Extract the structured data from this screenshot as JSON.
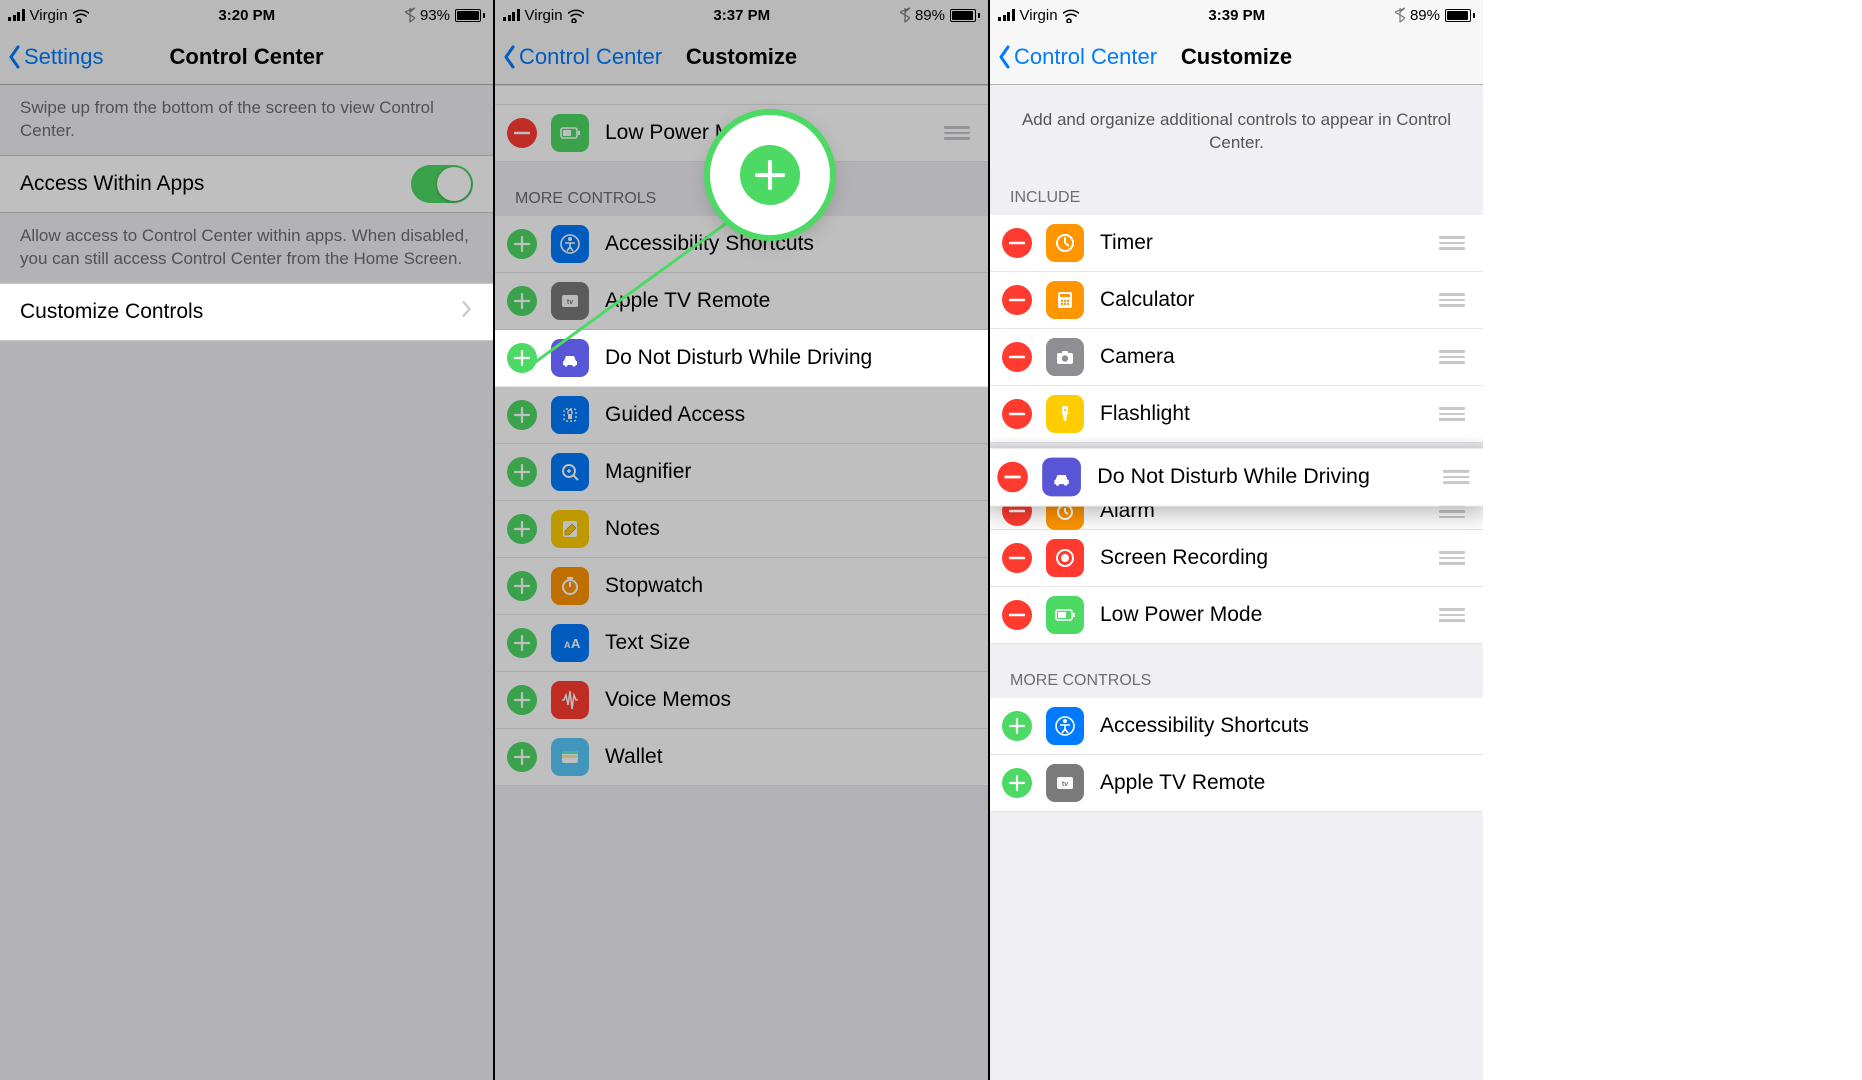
{
  "screen1": {
    "status": {
      "carrier": "Virgin",
      "time": "3:20 PM",
      "battery_pct": "93%",
      "battery_fill": 90
    },
    "nav": {
      "back": "Settings",
      "title": "Control Center"
    },
    "swipe_hint": "Swipe up from the bottom of the screen to view Control Center.",
    "access_cell": "Access Within Apps",
    "access_footer": "Allow access to Control Center within apps. When disabled, you can still access Control Center from the Home Screen.",
    "customize_cell": "Customize Controls"
  },
  "screen2": {
    "status": {
      "carrier": "Virgin",
      "time": "3:37 PM",
      "battery_pct": "89%",
      "battery_fill": 86
    },
    "nav": {
      "back": "Control Center",
      "title": "Customize"
    },
    "include_partial": {
      "low_power": "Low Power Mode"
    },
    "more_header": "MORE CONTROLS",
    "more": {
      "accessibility": "Accessibility Shortcuts",
      "apple_tv": "Apple TV Remote",
      "dnd_driving": "Do Not Disturb While Driving",
      "guided_access": "Guided Access",
      "magnifier": "Magnifier",
      "notes": "Notes",
      "stopwatch": "Stopwatch",
      "text_size": "Text Size",
      "voice_memos": "Voice Memos",
      "wallet": "Wallet"
    }
  },
  "screen3": {
    "status": {
      "carrier": "Virgin",
      "time": "3:39 PM",
      "battery_pct": "89%",
      "battery_fill": 86
    },
    "nav": {
      "back": "Control Center",
      "title": "Customize"
    },
    "intro": "Add and organize additional controls to appear in Control Center.",
    "include_header": "INCLUDE",
    "include": {
      "timer": "Timer",
      "calculator": "Calculator",
      "camera": "Camera",
      "flashlight": "Flashlight",
      "dnd_driving": "Do Not Disturb While Driving",
      "alarm": "Alarm",
      "screen_recording": "Screen Recording",
      "low_power": "Low Power Mode"
    },
    "more_header": "MORE CONTROLS",
    "more": {
      "accessibility": "Accessibility Shortcuts",
      "apple_tv": "Apple TV Remote"
    }
  }
}
